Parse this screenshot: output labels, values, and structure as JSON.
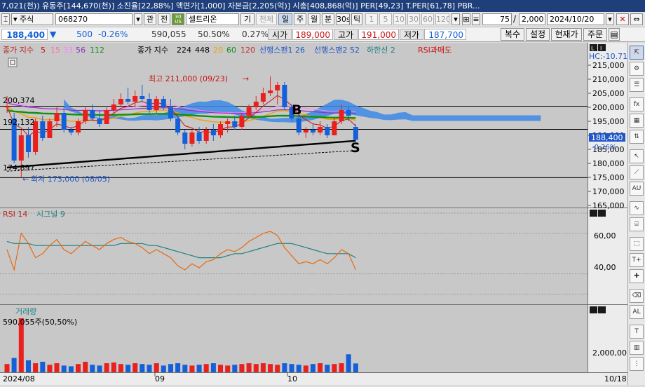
{
  "title_bar": {
    "text": "7,021(천)) 유동주[144,670(천)] 소진율[22,88%] 액면가[1,000] 자본금[2,205(억)] 시총[408,868(억)] PER[49,23] T.PER[61,78] PBR..."
  },
  "toolbar": {
    "market_type": "주식",
    "stock_code": "068270",
    "btn_gwan": "관",
    "btn_jeon": "전",
    "badge_top": "30",
    "badge_bottom": "US",
    "stock_name": "셀트리온",
    "btn_gi": "기",
    "btn_all": "전체",
    "periods": [
      "일",
      "주",
      "월",
      "분",
      "30s",
      "틱"
    ],
    "selected_period": "일",
    "intervals": [
      "1",
      "5",
      "10",
      "30",
      "60",
      "120"
    ],
    "count_value": "75",
    "total_count": "2,000",
    "date_value": "2024/10/20"
  },
  "quote": {
    "price": "188,400",
    "change_arrow": "▼",
    "change": "500",
    "change_pct": "-0.26%",
    "volume": "590,055",
    "volume_ratio": "50.50%",
    "turnover": "0.27%",
    "open_label": "시가",
    "open_value": "189,000",
    "high_label": "고가",
    "high_value": "191,000",
    "low_label": "저가",
    "low_value": "187,700",
    "btn_copy": "복수",
    "btn_settings": "설정",
    "btn_current": "현재가",
    "btn_order": "주문"
  },
  "chart_legend": {
    "ma_title": "종가 지수",
    "ma_periods": [
      "5",
      "15",
      "33",
      "56",
      "112"
    ],
    "ma_colors": [
      "#d01010",
      "#ff6fb0",
      "#ff7fff",
      "#9030c0",
      "#109010"
    ],
    "ma2_title": "종가 지수",
    "ma2_periods": [
      "224",
      "448",
      "20",
      "60",
      "120"
    ],
    "ma2_colors": [
      "#000000",
      "#000000",
      "#f0a000",
      "#109010",
      "#c03030"
    ],
    "ichimoku": "선행스팬1 26",
    "ichimoku2": "선행스팬2 52",
    "lagging": "하한선 2",
    "rsi_overbought": "RSI과매도"
  },
  "annotations": {
    "high_note": "최고 211,000 (09/23)",
    "low_note": "최저 173,000 (08/05)",
    "level_200": "200,374",
    "level_192": "192,132",
    "level_174": "174,897",
    "marker_b": "B",
    "marker_s": "S",
    "hc_label": "HC:-10.71",
    "price_tag": "188,400",
    "price_tag_pct": "-0.26%"
  },
  "price_axis": [
    "215,000",
    "210,000",
    "205,000",
    "200,000",
    "195,000",
    "190,000",
    "185,000",
    "180,000",
    "175,000",
    "170,000",
    "165,000"
  ],
  "rsi_panel": {
    "title": "RSI 14",
    "signal": "시그널 9",
    "axis": [
      "60,00",
      "40,00"
    ]
  },
  "volume_panel": {
    "title": "거래량",
    "value": "590,055주(50,50%)",
    "axis": [
      "2,000,00"
    ]
  },
  "x_axis": {
    "labels": [
      "2024/08",
      "09",
      "10"
    ],
    "right_label": "10/18"
  },
  "colors": {
    "up": "#e8201e",
    "down": "#1560d8",
    "cloud": "#3c8ae6",
    "chart_bg": "#c8c8c8"
  },
  "chart_data": {
    "type": "candlestick",
    "x_range": [
      "2024/08/01",
      "2024/10/18"
    ],
    "y_range": [
      165000,
      218000
    ],
    "candles": [
      {
        "o": 200000,
        "h": 204000,
        "l": 198000,
        "c": 200374
      },
      {
        "o": 196000,
        "h": 198000,
        "l": 180000,
        "c": 181000
      },
      {
        "o": 181000,
        "h": 192000,
        "l": 174897,
        "c": 190000
      },
      {
        "o": 190000,
        "h": 193000,
        "l": 182000,
        "c": 184000
      },
      {
        "o": 184000,
        "h": 196000,
        "l": 183000,
        "c": 195000
      },
      {
        "o": 195000,
        "h": 197000,
        "l": 188000,
        "c": 189000
      },
      {
        "o": 189000,
        "h": 196000,
        "l": 189000,
        "c": 195000
      },
      {
        "o": 195000,
        "h": 200000,
        "l": 193000,
        "c": 198000
      },
      {
        "o": 198000,
        "h": 200000,
        "l": 191000,
        "c": 192000
      },
      {
        "o": 192000,
        "h": 193000,
        "l": 190000,
        "c": 191000
      },
      {
        "o": 191000,
        "h": 196000,
        "l": 190000,
        "c": 195000
      },
      {
        "o": 195000,
        "h": 200000,
        "l": 194000,
        "c": 199000
      },
      {
        "o": 199000,
        "h": 201000,
        "l": 195000,
        "c": 196000
      },
      {
        "o": 196000,
        "h": 199000,
        "l": 193000,
        "c": 194000
      },
      {
        "o": 194000,
        "h": 200000,
        "l": 194000,
        "c": 199000
      },
      {
        "o": 199000,
        "h": 203000,
        "l": 198000,
        "c": 201000
      },
      {
        "o": 201000,
        "h": 205000,
        "l": 200000,
        "c": 203000
      },
      {
        "o": 203000,
        "h": 207000,
        "l": 201000,
        "c": 202000
      },
      {
        "o": 202000,
        "h": 206000,
        "l": 200000,
        "c": 204000
      },
      {
        "o": 204000,
        "h": 208000,
        "l": 202000,
        "c": 203000
      },
      {
        "o": 203000,
        "h": 205000,
        "l": 198000,
        "c": 199000
      },
      {
        "o": 199000,
        "h": 204000,
        "l": 198000,
        "c": 203000
      },
      {
        "o": 203000,
        "h": 204000,
        "l": 199000,
        "c": 200000
      },
      {
        "o": 200000,
        "h": 203000,
        "l": 195000,
        "c": 196000
      },
      {
        "o": 196000,
        "h": 197000,
        "l": 190000,
        "c": 191000
      },
      {
        "o": 191000,
        "h": 192000,
        "l": 185000,
        "c": 187000
      },
      {
        "o": 187000,
        "h": 192000,
        "l": 186000,
        "c": 191000
      },
      {
        "o": 191000,
        "h": 193000,
        "l": 187000,
        "c": 188000
      },
      {
        "o": 188000,
        "h": 193000,
        "l": 187000,
        "c": 192000
      },
      {
        "o": 192000,
        "h": 194000,
        "l": 188000,
        "c": 190000
      },
      {
        "o": 190000,
        "h": 195000,
        "l": 189000,
        "c": 194000
      },
      {
        "o": 194000,
        "h": 196000,
        "l": 191000,
        "c": 195000
      },
      {
        "o": 195000,
        "h": 197000,
        "l": 192000,
        "c": 193000
      },
      {
        "o": 193000,
        "h": 198000,
        "l": 192000,
        "c": 197000
      },
      {
        "o": 197000,
        "h": 201000,
        "l": 196000,
        "c": 200000
      },
      {
        "o": 200000,
        "h": 204000,
        "l": 199000,
        "c": 202000
      },
      {
        "o": 202000,
        "h": 207000,
        "l": 201000,
        "c": 205000
      },
      {
        "o": 205000,
        "h": 211000,
        "l": 204000,
        "c": 206000
      },
      {
        "o": 206000,
        "h": 209000,
        "l": 201000,
        "c": 208000
      },
      {
        "o": 208000,
        "h": 209000,
        "l": 199000,
        "c": 200000
      },
      {
        "o": 200000,
        "h": 201000,
        "l": 195000,
        "c": 196000
      },
      {
        "o": 196000,
        "h": 198000,
        "l": 190000,
        "c": 191000
      },
      {
        "o": 191000,
        "h": 193000,
        "l": 189000,
        "c": 192000
      },
      {
        "o": 192000,
        "h": 194000,
        "l": 190000,
        "c": 191000
      },
      {
        "o": 191000,
        "h": 195000,
        "l": 190000,
        "c": 193000
      },
      {
        "o": 193000,
        "h": 194000,
        "l": 189000,
        "c": 190000
      },
      {
        "o": 190000,
        "h": 196000,
        "l": 190000,
        "c": 195000
      },
      {
        "o": 195000,
        "h": 201000,
        "l": 194000,
        "c": 199000
      },
      {
        "o": 199000,
        "h": 200000,
        "l": 195000,
        "c": 197000
      },
      {
        "o": 193000,
        "h": 194000,
        "l": 187700,
        "c": 188400
      }
    ],
    "volumes": [
      0.55,
      0.95,
      3.6,
      0.8,
      0.6,
      0.7,
      0.5,
      0.6,
      0.45,
      0.4,
      0.55,
      0.7,
      0.5,
      0.45,
      0.6,
      0.65,
      0.55,
      0.5,
      0.6,
      0.55,
      0.5,
      0.6,
      0.45,
      0.55,
      0.6,
      0.5,
      0.45,
      0.5,
      0.55,
      0.6,
      0.5,
      0.45,
      0.5,
      0.55,
      0.6,
      0.55,
      0.6,
      0.55,
      0.5,
      0.6,
      0.55,
      0.5,
      0.45,
      0.55,
      0.6,
      0.5,
      0.55,
      0.6,
      1.2,
      0.59
    ],
    "rsi": [
      52,
      42,
      60,
      55,
      48,
      50,
      54,
      57,
      52,
      50,
      53,
      56,
      54,
      52,
      55,
      57,
      58,
      56,
      55,
      53,
      50,
      52,
      50,
      48,
      44,
      42,
      45,
      43,
      46,
      47,
      50,
      52,
      51,
      53,
      56,
      58,
      60,
      61,
      59,
      53,
      49,
      45,
      46,
      45,
      47,
      45,
      48,
      52,
      50,
      42
    ],
    "rsi_signal": [
      56,
      55,
      55,
      55,
      54,
      54,
      54,
      54,
      54,
      54,
      54,
      54,
      54,
      54,
      54,
      54,
      55,
      55,
      55,
      55,
      54,
      54,
      53,
      52,
      51,
      50,
      49,
      48,
      48,
      48,
      48,
      49,
      50,
      50,
      51,
      52,
      53,
      54,
      55,
      55,
      55,
      54,
      53,
      52,
      51,
      50,
      50,
      50,
      50,
      48
    ]
  }
}
